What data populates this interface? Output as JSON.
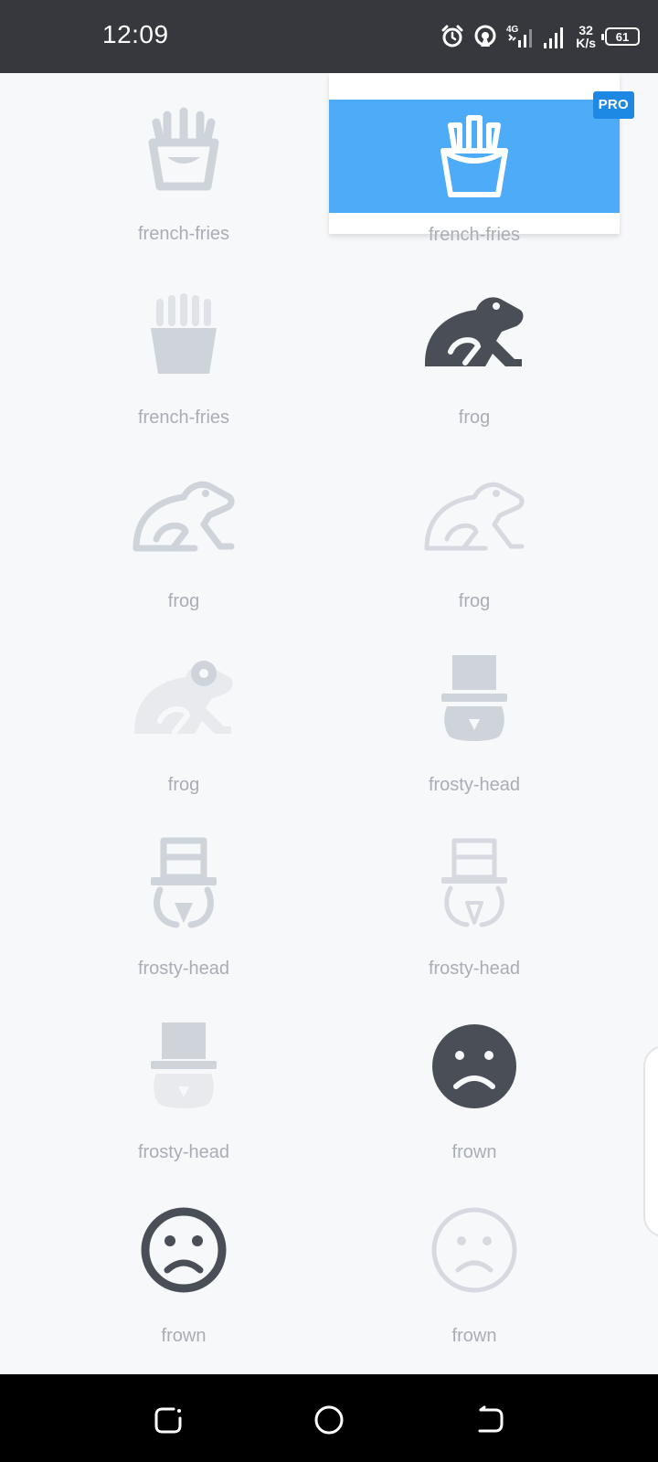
{
  "status_bar": {
    "time": "12:09",
    "network_type": "4G",
    "speed_value": "32",
    "speed_unit": "K/s",
    "battery": "61",
    "icons": [
      "alarm-icon",
      "hotspot-icon",
      "signal-4g-icon",
      "signal-icon",
      "battery-icon"
    ]
  },
  "badge": {
    "pro": "PRO"
  },
  "colors": {
    "selected_bg": "#4dabf7",
    "pro_badge": "#1e88e5",
    "icon_dark": "#4a4f57",
    "icon_light": "#cfd3da",
    "label": "#a9adb5"
  },
  "icons": [
    {
      "name": "french-fries",
      "style": "light",
      "selected": false
    },
    {
      "name": "french-fries",
      "style": "selected",
      "selected": true,
      "pro": true
    },
    {
      "name": "french-fries",
      "style": "solid-light",
      "selected": false
    },
    {
      "name": "frog",
      "style": "dark",
      "selected": false
    },
    {
      "name": "frog",
      "style": "outline-light",
      "selected": false
    },
    {
      "name": "frog",
      "style": "outline-light",
      "selected": false
    },
    {
      "name": "frog",
      "style": "duotone-light",
      "selected": false
    },
    {
      "name": "frosty-head",
      "style": "solid-light",
      "selected": false
    },
    {
      "name": "frosty-head",
      "style": "outline-light",
      "selected": false
    },
    {
      "name": "frosty-head",
      "style": "outline-light",
      "selected": false
    },
    {
      "name": "frosty-head",
      "style": "duotone-light",
      "selected": false
    },
    {
      "name": "frown",
      "style": "dark",
      "selected": false
    },
    {
      "name": "frown",
      "style": "outline-dark",
      "selected": false
    },
    {
      "name": "frown",
      "style": "outline-light",
      "selected": false
    }
  ],
  "nav": [
    "recent-apps-icon",
    "home-icon",
    "back-icon"
  ]
}
